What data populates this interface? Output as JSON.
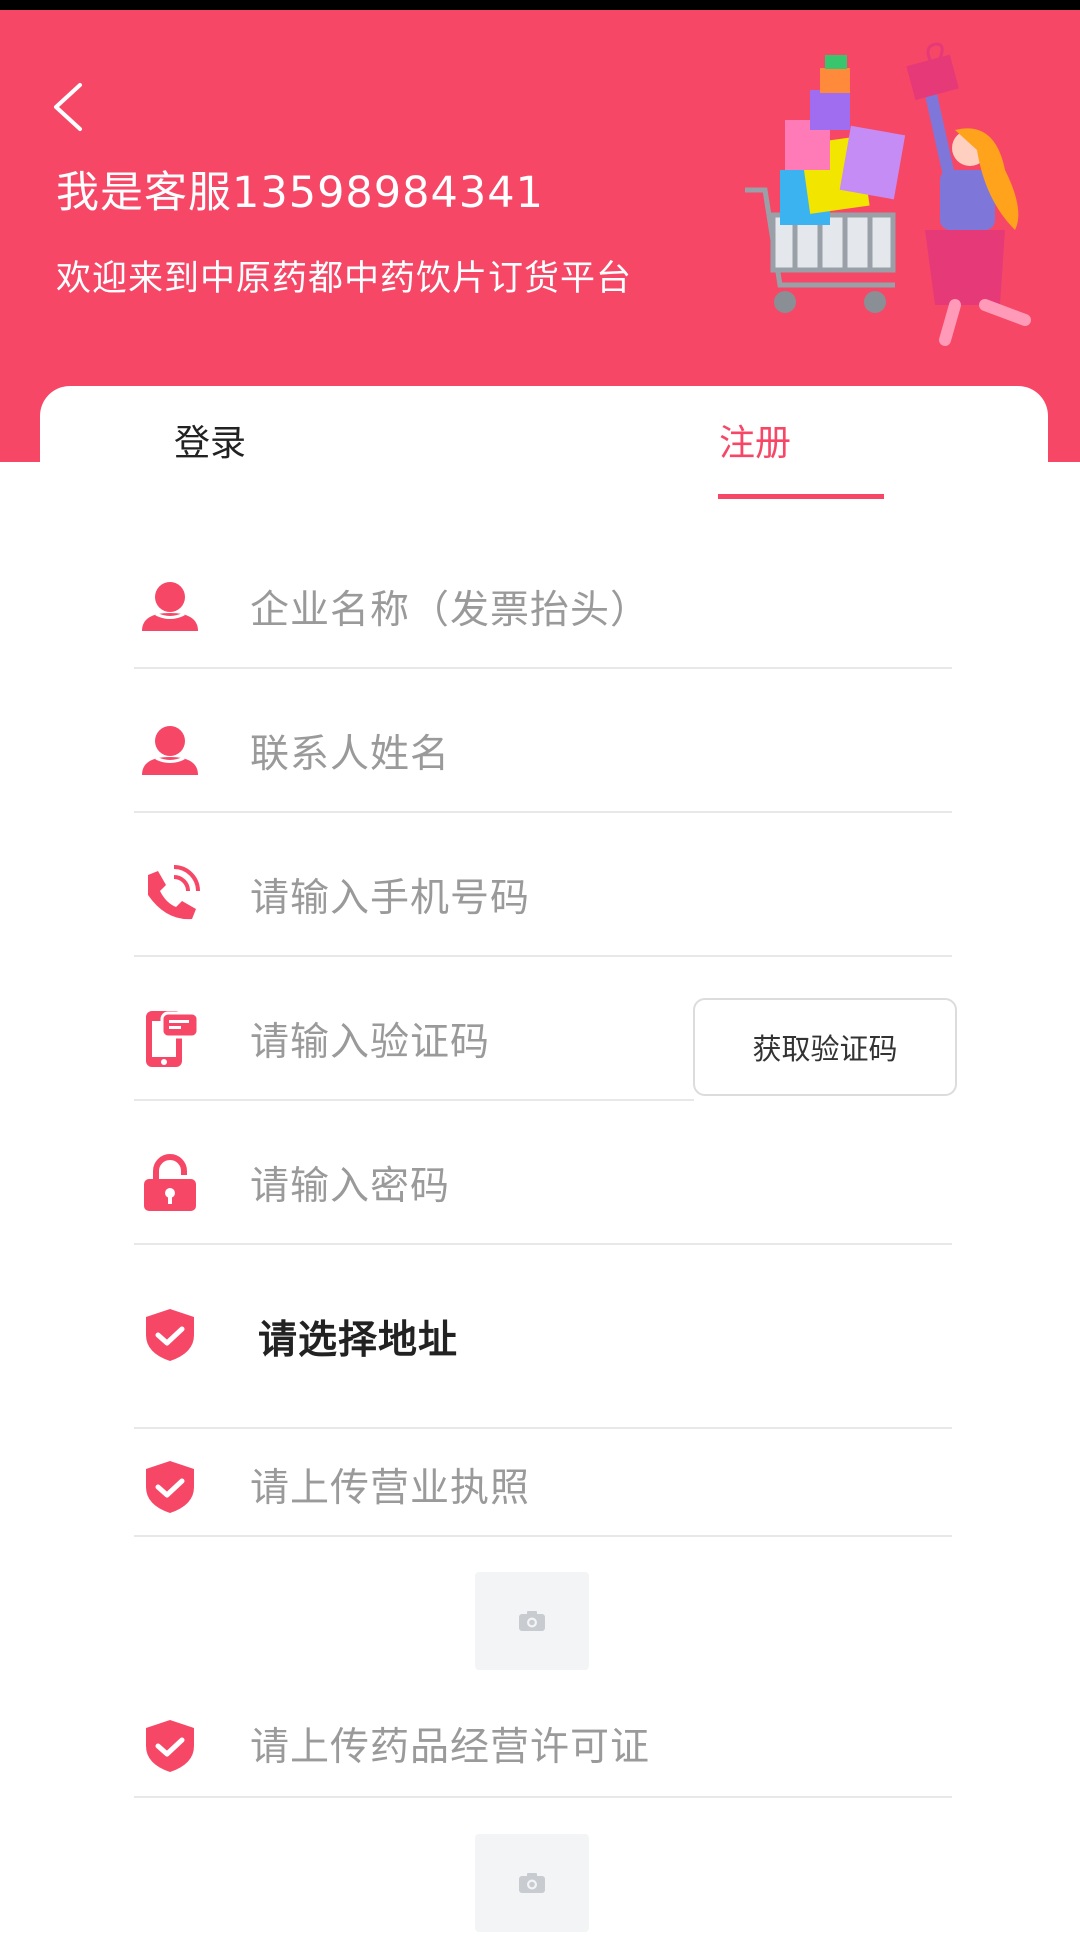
{
  "header": {
    "title": "我是客服13598984341",
    "subtitle": "欢迎来到中原药都中药饮片订货平台"
  },
  "tabs": [
    {
      "label": "登录"
    },
    {
      "label": "注册"
    }
  ],
  "fields": [
    {
      "placeholder": "企业名称（发票抬头）",
      "icon": "user-icon"
    },
    {
      "placeholder": "联系人姓名",
      "icon": "user-icon"
    },
    {
      "placeholder": "请输入手机号码",
      "icon": "phone-call-icon"
    },
    {
      "placeholder": "请输入验证码",
      "icon": "sms-phone-icon"
    },
    {
      "placeholder": "请输入密码",
      "icon": "lock-icon"
    },
    {
      "value": "请选择地址",
      "icon": "shield-check-icon"
    },
    {
      "label": "请上传营业执照",
      "icon": "shield-check-icon"
    },
    {
      "label": "请上传药品经营许可证",
      "icon": "shield-check-icon"
    }
  ],
  "buttons": {
    "get_code": "获取验证码"
  },
  "colors": {
    "accent": "#f74767",
    "placeholder": "#9a9a9a"
  }
}
